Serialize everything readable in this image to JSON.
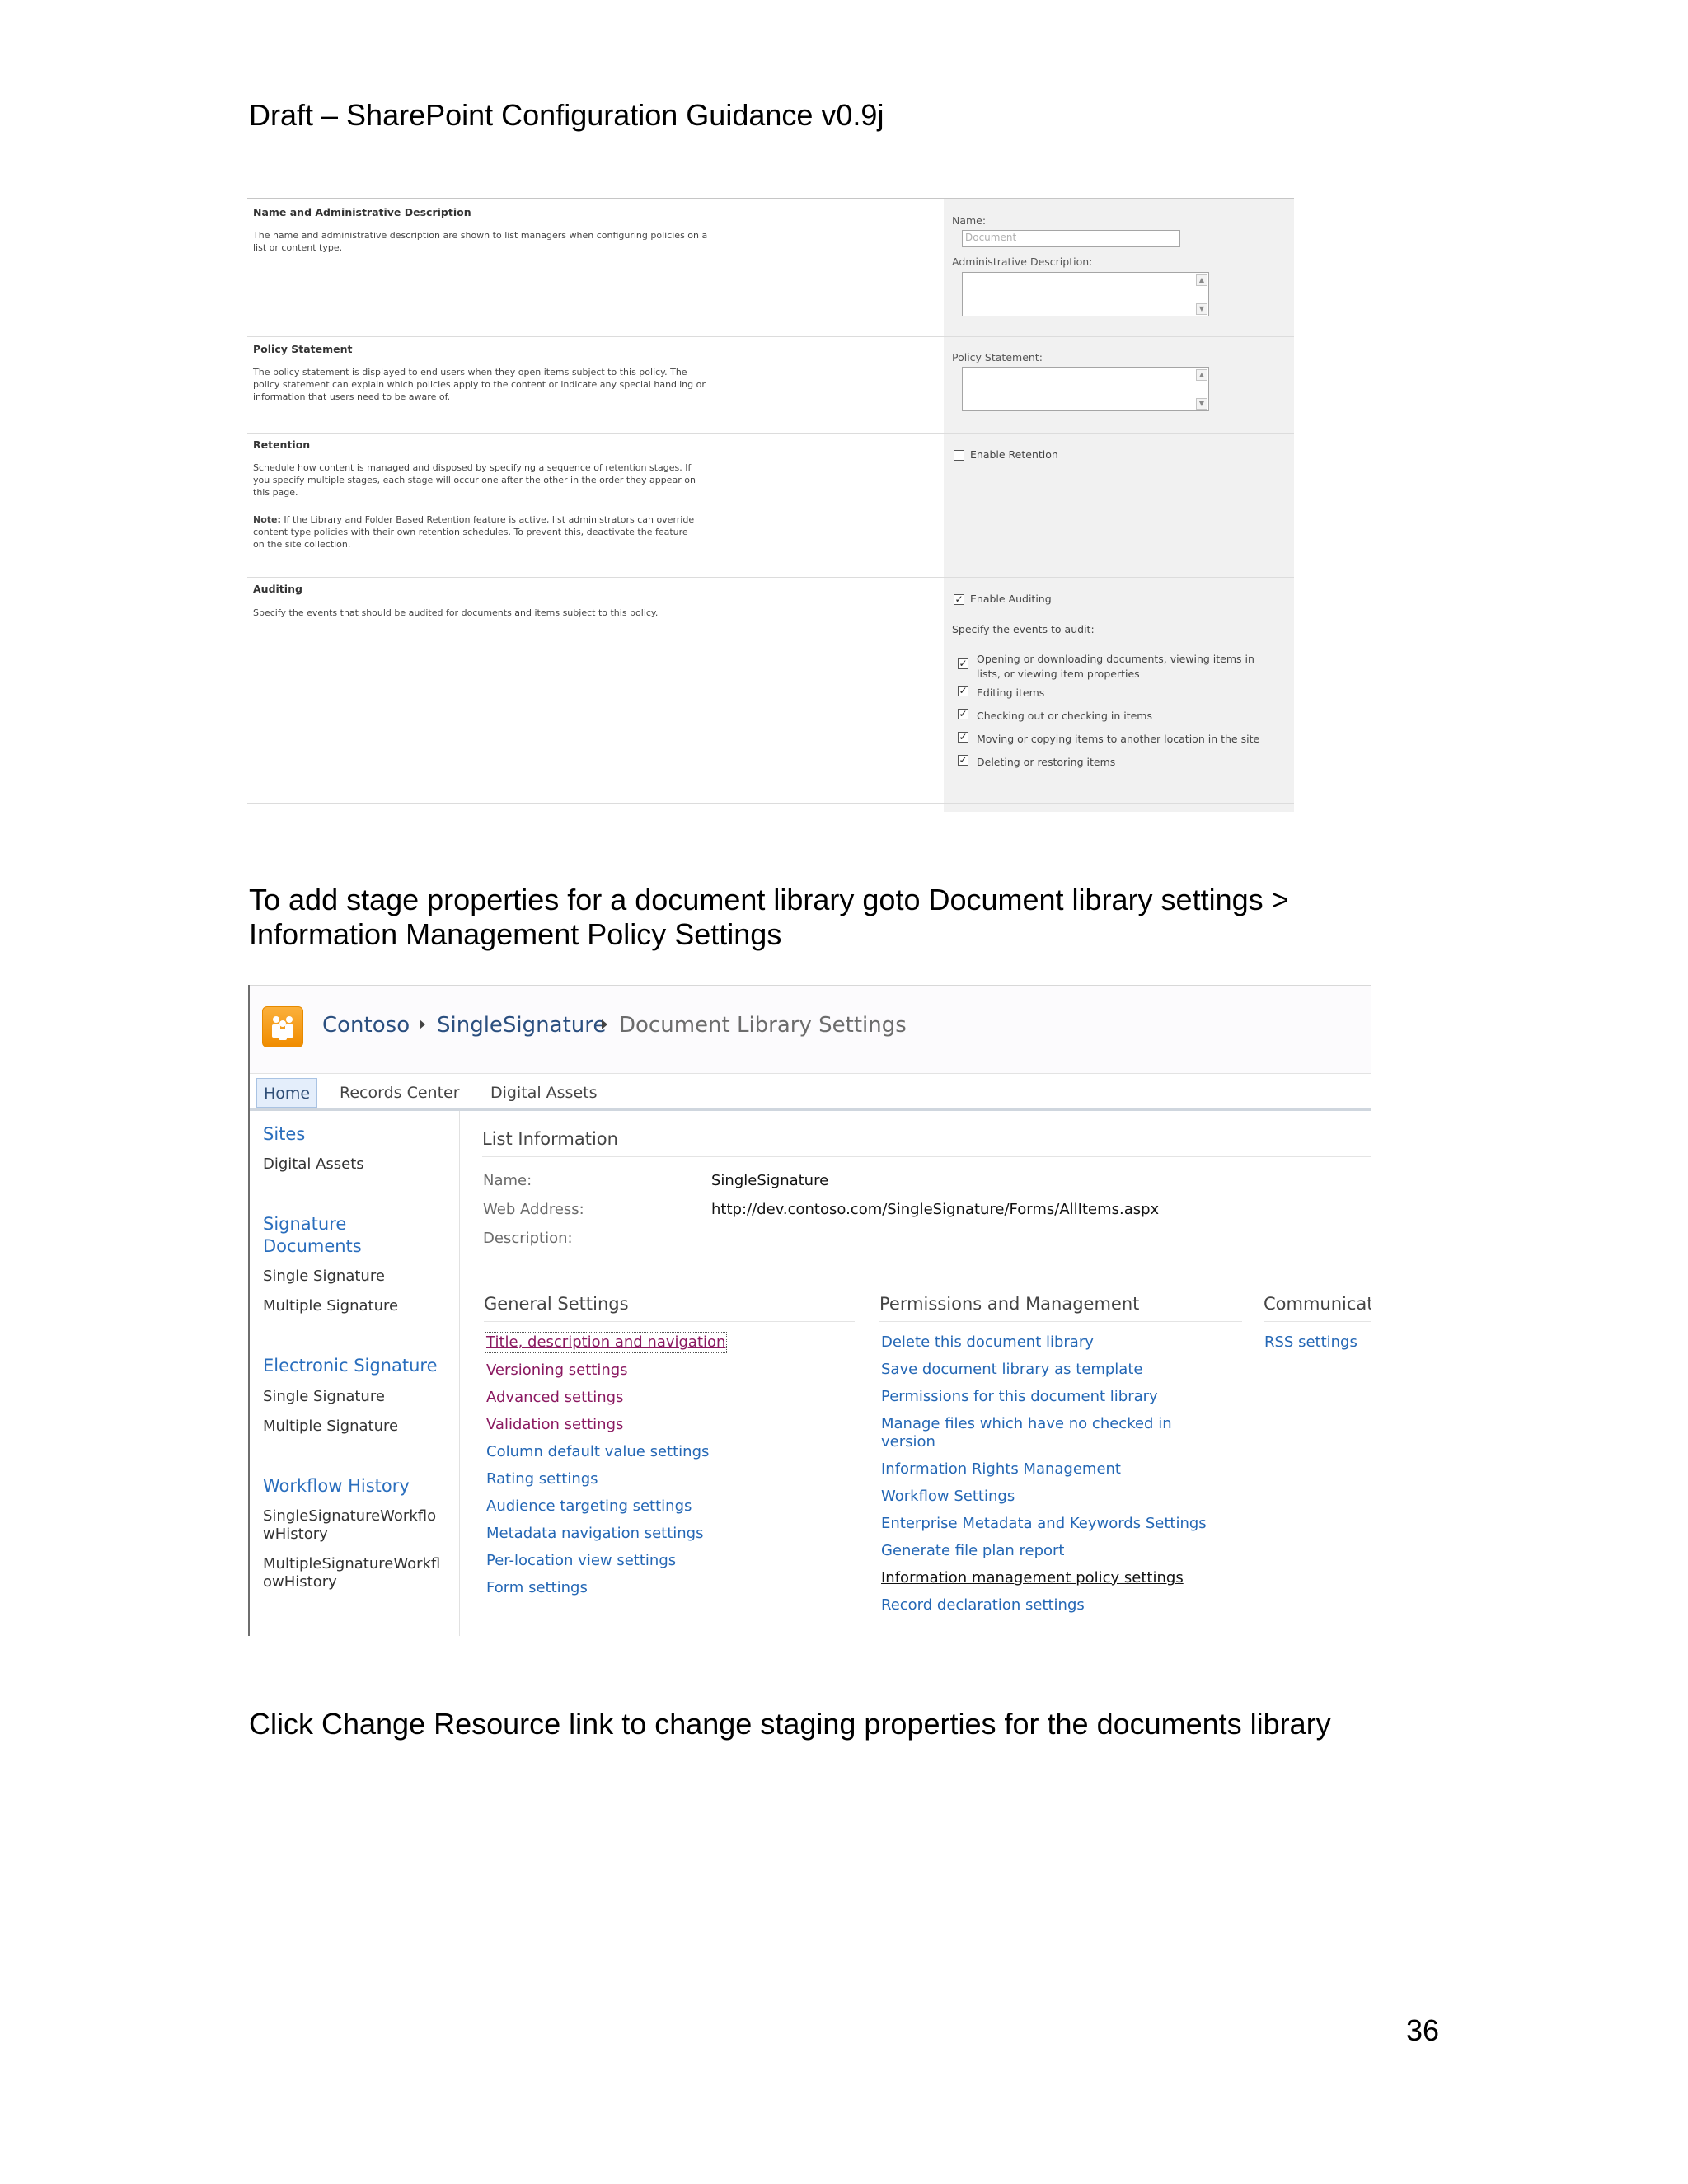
{
  "page": {
    "header": "Draft – SharePoint Configuration Guidance v0.9j",
    "paragraph_1_line_1": "To add stage properties for a document library goto Document library settings >",
    "paragraph_1_line_2": "Information Management Policy Settings",
    "paragraph_2": "Click Change Resource link to change staging properties for the documents library",
    "page_number": "36"
  },
  "policy_form": {
    "name_section": {
      "title": "Name and Administrative Description",
      "text_1": "The name and administrative description are shown to list managers when configuring policies on a",
      "text_2": "list or content type.",
      "name_label": "Name:",
      "name_value": "Document",
      "admin_desc_label": "Administrative Description:"
    },
    "policy_section": {
      "title": "Policy Statement",
      "text_1": "The policy statement is displayed to end users when they open items subject to this policy. The",
      "text_2": "policy statement can explain which policies apply to the content or indicate any special handling or",
      "text_3": "information that users need to be aware of.",
      "field_label": "Policy Statement:"
    },
    "retention_section": {
      "title": "Retention",
      "text_1": "Schedule how content is managed and disposed by specifying a sequence of retention stages. If",
      "text_2": "you specify multiple stages, each stage will occur one after the other in the order they appear on",
      "text_3": "this page.",
      "note_label": "Note:",
      "note_1": " If the Library and Folder Based Retention feature is active, list administrators can override",
      "note_2": "content type policies with their own retention schedules.  To prevent this, deactivate the feature",
      "note_3": "on the site collection.",
      "checkbox_label": "Enable Retention",
      "checkbox_checked": false
    },
    "auditing_section": {
      "title": "Auditing",
      "text": "Specify the events that should be audited for documents and items subject to this policy.",
      "enable_label": "Enable Auditing",
      "enable_checked": true,
      "events_label": "Specify the events to audit:",
      "events": [
        {
          "line_1": "Opening or downloading documents, viewing items in",
          "line_2": "lists, or viewing item properties",
          "checked": true
        },
        {
          "line_1": "Editing items",
          "line_2": "",
          "checked": true
        },
        {
          "line_1": "Checking out or checking in items",
          "line_2": "",
          "checked": true
        },
        {
          "line_1": "Moving or copying items to another location in the site",
          "line_2": "",
          "checked": true
        },
        {
          "line_1": "Deleting or restoring items",
          "line_2": "",
          "checked": true
        }
      ]
    }
  },
  "library_settings": {
    "breadcrumb": [
      "Contoso",
      "SingleSignature",
      "Document Library Settings"
    ],
    "tabs": [
      "Home",
      "Records Center",
      "Digital Assets"
    ],
    "left_nav": {
      "sites_head": "Sites",
      "sites_items": [
        "Digital Assets"
      ],
      "signature_head_1": "Signature",
      "signature_head_2": "Documents",
      "signature_items": [
        "Single Signature",
        "Multiple Signature"
      ],
      "electronic_head": "Electronic Signature",
      "electronic_items": [
        "Single Signature",
        "Multiple Signature"
      ],
      "workflow_head": "Workflow History",
      "workflow_items": [
        {
          "line_1": "SingleSignatureWorkflo",
          "line_2": "wHistory"
        },
        {
          "line_1": "MultipleSignatureWorkfl",
          "line_2": "owHistory"
        }
      ]
    },
    "list_info": {
      "title": "List Information",
      "name_label": "Name:",
      "name_value": "SingleSignature",
      "web_label": "Web Address:",
      "web_value": "http://dev.contoso.com/SingleSignature/Forms/AllItems.aspx",
      "desc_label": "Description:"
    },
    "general": {
      "title": "General Settings",
      "links": [
        "Title, description and navigation",
        "Versioning settings",
        "Advanced settings",
        "Validation settings",
        "Column default value settings",
        "Rating settings",
        "Audience targeting settings",
        "Metadata navigation settings",
        "Per-location view settings",
        "Form settings"
      ]
    },
    "permissions": {
      "title": "Permissions and Management",
      "links": [
        "Delete this document library",
        "Save document library as template",
        "Permissions for this document library",
        "Manage files which have no checked in",
        "version",
        "Information Rights Management",
        "Workflow Settings",
        "Enterprise Metadata and Keywords Settings",
        "Generate file plan report",
        "Information management policy settings",
        "Record declaration settings"
      ]
    },
    "communications": {
      "title": "Communicat",
      "links": [
        "RSS settings"
      ]
    }
  }
}
